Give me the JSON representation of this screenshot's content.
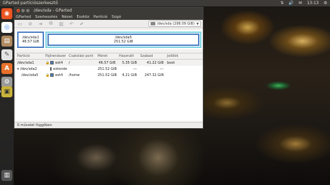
{
  "panel": {
    "title": "GParted partíciószerkesztő",
    "tray": [
      "⇅",
      "🔊",
      "✉"
    ],
    "clock": "13:13"
  },
  "launcher": {
    "items": [
      {
        "name": "ubuntu-logo-icon",
        "glyph": "◉",
        "color": "#e95420"
      },
      {
        "name": "chrome-icon",
        "glyph": "◎",
        "color": "#4285f4"
      },
      {
        "name": "files-icon",
        "glyph": "▤",
        "color": "#b08a60"
      },
      {
        "name": "text-editor-icon",
        "glyph": "✎",
        "color": "#e4e4e4"
      },
      {
        "name": "software-center-icon",
        "glyph": "A",
        "color": "#e8702a"
      },
      {
        "name": "settings-icon",
        "glyph": "⚙",
        "color": "#9a9a9a"
      },
      {
        "name": "gparted-icon",
        "glyph": "▣",
        "color": "#c8b23a"
      },
      {
        "name": "trash-icon",
        "glyph": "🗑",
        "color": "#666"
      }
    ]
  },
  "window": {
    "title": "/dev/sda - GParted",
    "menu": [
      "GParted",
      "Szerkesztés",
      "Nézet",
      "Eszköz",
      "Partíció",
      "Súgó"
    ],
    "device": "/dev/sda  (298.09 GiB)"
  },
  "graph": {
    "sda1": {
      "name": "/dev/sda1",
      "size": "46.57 GiB"
    },
    "sda5": {
      "name": "/dev/sda5",
      "size": "251.52 GiB"
    }
  },
  "table": {
    "headers": [
      "Partíció",
      "Fájlrendszer",
      "Csatolási pont",
      "Méret",
      "Használt",
      "Szabad",
      "Jelölők"
    ],
    "rows": [
      {
        "partition": "/dev/sda1",
        "fs": "ext4",
        "fs_color": "#4e80c4",
        "mount": "/",
        "size": "46.57 GiB",
        "used": "5.35 GiB",
        "unused": "41.22 GiB",
        "flags": "boot",
        "lock": true
      },
      {
        "partition": "/dev/sda2",
        "fs": "extended",
        "fs_color": "#7cd4e0",
        "mount": "",
        "size": "251.52 GiB",
        "used": "---",
        "unused": "---",
        "flags": "",
        "lock": false
      },
      {
        "partition": "/dev/sda5",
        "fs": "ext4",
        "fs_color": "#4e80c4",
        "mount": "/home",
        "size": "251.52 GiB",
        "used": "4.21 GiB",
        "unused": "247.32 GiB",
        "flags": "",
        "lock": true
      }
    ]
  },
  "status": "0 művelet függőben"
}
